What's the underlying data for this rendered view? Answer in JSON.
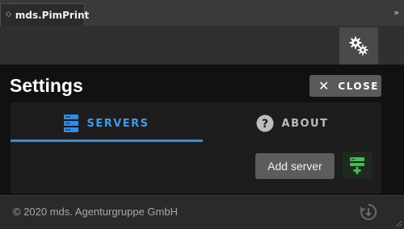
{
  "window": {
    "tab_title": "mds.PimPrint",
    "tab_arrows": "◇",
    "collapse_glyph": "»"
  },
  "settings": {
    "title": "Settings",
    "close_label": "CLOSE"
  },
  "tabs": [
    {
      "label": "SERVERS",
      "active": true
    },
    {
      "label": "ABOUT",
      "active": false
    }
  ],
  "servers": {
    "add_button_label": "Add server"
  },
  "footer": {
    "copyright": "© 2020 mds. Agenturgruppe GmbH"
  },
  "icons": {
    "settings": "gears-icon",
    "close": "close-icon",
    "servers": "server-stack-icon",
    "about": "question-circle-icon",
    "add_server": "server-add-icon",
    "update": "update-download-icon"
  },
  "colors": {
    "accent_blue": "#2f8fe4",
    "add_green": "#3fbf4f",
    "heading": "#ffffff"
  }
}
